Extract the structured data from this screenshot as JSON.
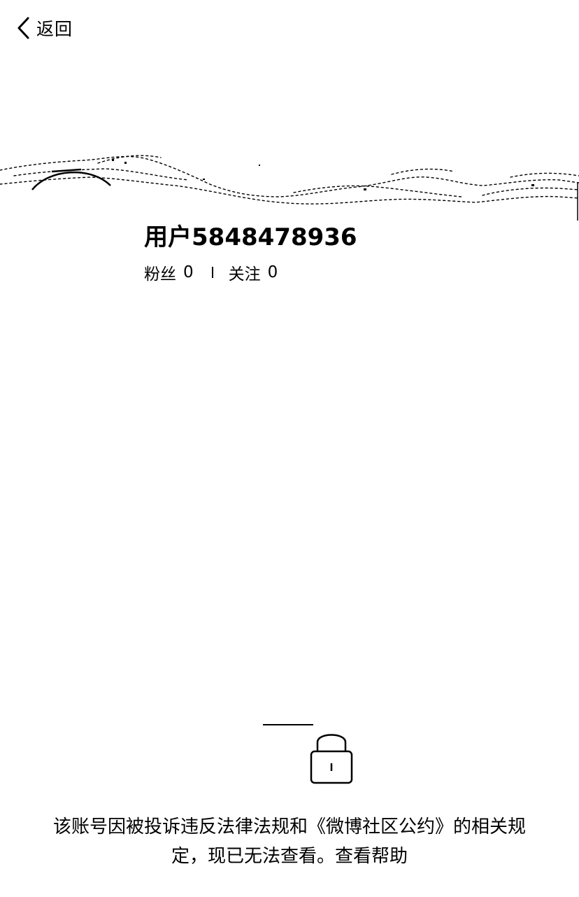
{
  "header": {
    "back_label": "返回",
    "back_icon": "chevron-left-icon"
  },
  "profile": {
    "username": "用户5848478936",
    "followers_label": "粉丝",
    "followers_count": "0",
    "following_label": "关注",
    "following_count": "0"
  },
  "notice": {
    "icon": "lock-icon",
    "message": "该账号因被投诉违反法律法规和《微博社区公约》的相关规定，现已无法查看。",
    "help_link": "查看帮助"
  }
}
